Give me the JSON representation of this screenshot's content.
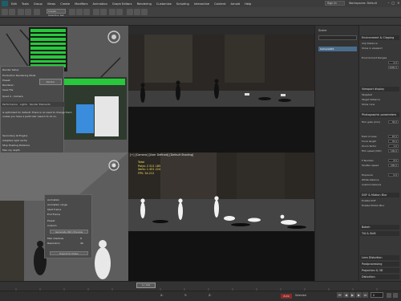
{
  "app": {
    "menu": [
      "Edit",
      "Tools",
      "Group",
      "Views",
      "Create",
      "Modifiers",
      "Animation",
      "Graph Editors",
      "Rendering",
      "Customize",
      "Scripting",
      "Interactive",
      "Content",
      "Arnold",
      "Help"
    ],
    "sign_in": "Sign In",
    "workspace": "Workspaces: Default",
    "selection_set": "Create Selection Set"
  },
  "render_dialog": {
    "title": "Render Setup",
    "target_label": "Target:",
    "target_value": "Production Rendering Mode",
    "preset_label": "Preset:",
    "renderer_label": "Renderer:",
    "save_file": "Save File",
    "render_button": "Render",
    "view_label": "View to Render:",
    "view_value": "Quad 4 - Camera",
    "tabs": [
      "Performance",
      "Lights",
      "Render Elements"
    ],
    "info_1": "is optimized for default. There is no need to change them",
    "info_2": "unless you have a particular reason to do so.",
    "rows": [
      "Secondary GI Engine",
      "Adaptive light cache",
      "Stop Shading Distance",
      "Max ray depth",
      "Shadow rays",
      "Force Path Tracing",
      "Fall precision (slower startup renders)",
      "Use in All Dialogs",
      "Caustic Photon Map"
    ]
  },
  "stream_panel": {
    "rows": [
      "Animation",
      "Animation range",
      "Start frame",
      "End Frame",
      "Preset",
      "Custom"
    ],
    "buttons": [
      "Generate (NC) Preview",
      "Export to Video"
    ],
    "fields": [
      "Max shadows",
      "Resolution"
    ],
    "values": [
      "8",
      "4K"
    ]
  },
  "viewports": {
    "top_right_label": "",
    "bottom_right_label": "[+] [Camera] [User Defined] [Default Shading]",
    "stats": [
      "Total",
      "Polys: 2 521 185",
      "Verts: 1 451 224",
      "FPS: 34.212"
    ]
  },
  "scene_list": {
    "header": "Scene",
    "item": "Camera001"
  },
  "props": {
    "rollouts": [
      "Environment & Clipping",
      "Viewport display",
      "Photographic parameters",
      "DOF & Motion Blur",
      "Bokeh",
      "Tilt & Shift",
      "Lens Distortion",
      "Postprocessing",
      "Projection & 3D",
      "Distortion"
    ],
    "items": [
      "Clip Distance",
      "Show in viewport",
      "Environment Ranges",
      "Targeted",
      "Target distance",
      "Show cone",
      "Show horizon",
      "Film gate (mm)",
      "Field of view",
      "Focal length",
      "Zoom factor",
      "Film speed (ISO)",
      "F-Number",
      "Shutter speed",
      "Exposure",
      "White balance",
      "Custom balance",
      "Enable Bokeh",
      "Enable DOF",
      "Enable Motion Blur"
    ],
    "values": [
      "0.0",
      "1000.0",
      "36.0",
      "45.0",
      "35.0",
      "1.0",
      "100.0",
      "8.0",
      "200.0",
      "0.0"
    ]
  },
  "timeline": {
    "frame": "0 / 100",
    "current_frame": "0"
  },
  "status": {
    "x": "X: ",
    "y": "Y: ",
    "z": "Z: ",
    "auto": "Auto",
    "selected": "Selected"
  },
  "colors": {
    "accent": "#4a6c8c",
    "stats_text": "#f0e060",
    "panel": "#383838"
  }
}
